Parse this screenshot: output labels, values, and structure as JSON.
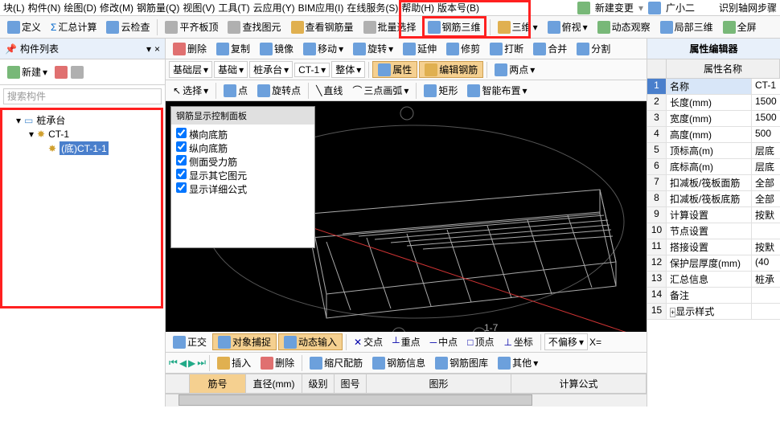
{
  "menu": {
    "items": [
      "块(L)",
      "构件(N)",
      "绘图(D)",
      "修改(M)",
      "钢筋量(Q)",
      "视图(V)",
      "工具(T)",
      "云应用(Y)",
      "BIM应用(I)",
      "在线服务(S)",
      "帮助(H)",
      "版本号(B)"
    ],
    "right": {
      "new_change": "新建变更",
      "user": "广小二",
      "axis": "识别轴网步骤"
    }
  },
  "toolbar1": {
    "define": "定义",
    "calc": "汇总计算",
    "cloud": "云检查",
    "flat": "平齐板顶",
    "find": "查找图元",
    "view_rebar": "查看钢筋量",
    "batch": "批量选择",
    "rebar3d": "钢筋三维",
    "d3": "三维",
    "pv": "俯视",
    "dyn": "动态观察",
    "local3d": "局部三维",
    "full": "全屏"
  },
  "left": {
    "title": "构件列表",
    "new": "新建",
    "search_ph": "搜索构件",
    "tree": {
      "root": "桩承台",
      "child": "CT-1",
      "leaf": "(底)CT-1-1"
    }
  },
  "tr2": {
    "del": "删除",
    "copy": "复制",
    "mirror": "镜像",
    "move": "移动",
    "rotate": "旋转",
    "extend": "延伸",
    "trim": "修剪",
    "break": "打断",
    "merge": "合并",
    "split": "分割"
  },
  "tr3": {
    "lvl": "基础层",
    "cat": "基础",
    "type": "桩承台",
    "cmp": "CT-1",
    "whole": "整体",
    "attr": "属性",
    "edit_rebar": "编辑钢筋",
    "two_pt": "两点"
  },
  "tr4": {
    "sel": "选择",
    "pt": "点",
    "rot_pt": "旋转点",
    "line": "直线",
    "arc": "三点画弧",
    "rect": "矩形",
    "smart": "智能布置"
  },
  "panel": {
    "title": "钢筋显示控制面板",
    "items": [
      "横向底筋",
      "纵向底筋",
      "侧面受力筋",
      "显示其它图元",
      "显示详细公式"
    ]
  },
  "axis_label": "1-7",
  "status": {
    "ortho": "正交",
    "snap": "对象捕捉",
    "dyn": "动态输入",
    "jd": "交点",
    "zd": "重点",
    "md": "中点",
    "dd": "顶点",
    "zb": "坐标",
    "off": "不偏移",
    "x": "X="
  },
  "tr5": {
    "ins": "插入",
    "del": "删除",
    "scale": "缩尺配筋",
    "info": "钢筋信息",
    "lib": "钢筋图库",
    "other": "其他"
  },
  "grid": {
    "cols": [
      "",
      "筋号",
      "直径(mm)",
      "级别",
      "图号",
      "图形",
      "计算公式"
    ]
  },
  "props": {
    "title": "属性编辑器",
    "name_col": "属性名称",
    "rows": [
      {
        "i": "1",
        "n": "名称",
        "v": "CT-1"
      },
      {
        "i": "2",
        "n": "长度(mm)",
        "v": "1500"
      },
      {
        "i": "3",
        "n": "宽度(mm)",
        "v": "1500"
      },
      {
        "i": "4",
        "n": "高度(mm)",
        "v": "500"
      },
      {
        "i": "5",
        "n": "顶标高(m)",
        "v": "层底"
      },
      {
        "i": "6",
        "n": "底标高(m)",
        "v": "层底"
      },
      {
        "i": "7",
        "n": "扣减板/筏板面筋",
        "v": "全部"
      },
      {
        "i": "8",
        "n": "扣减板/筏板底筋",
        "v": "全部"
      },
      {
        "i": "9",
        "n": "计算设置",
        "v": "按默"
      },
      {
        "i": "10",
        "n": "节点设置",
        "v": ""
      },
      {
        "i": "11",
        "n": "搭接设置",
        "v": "按默"
      },
      {
        "i": "12",
        "n": "保护层厚度(mm)",
        "v": "(40"
      },
      {
        "i": "13",
        "n": "汇总信息",
        "v": "桩承"
      },
      {
        "i": "14",
        "n": "备注",
        "v": ""
      },
      {
        "i": "15",
        "n": "显示样式",
        "v": ""
      }
    ]
  }
}
